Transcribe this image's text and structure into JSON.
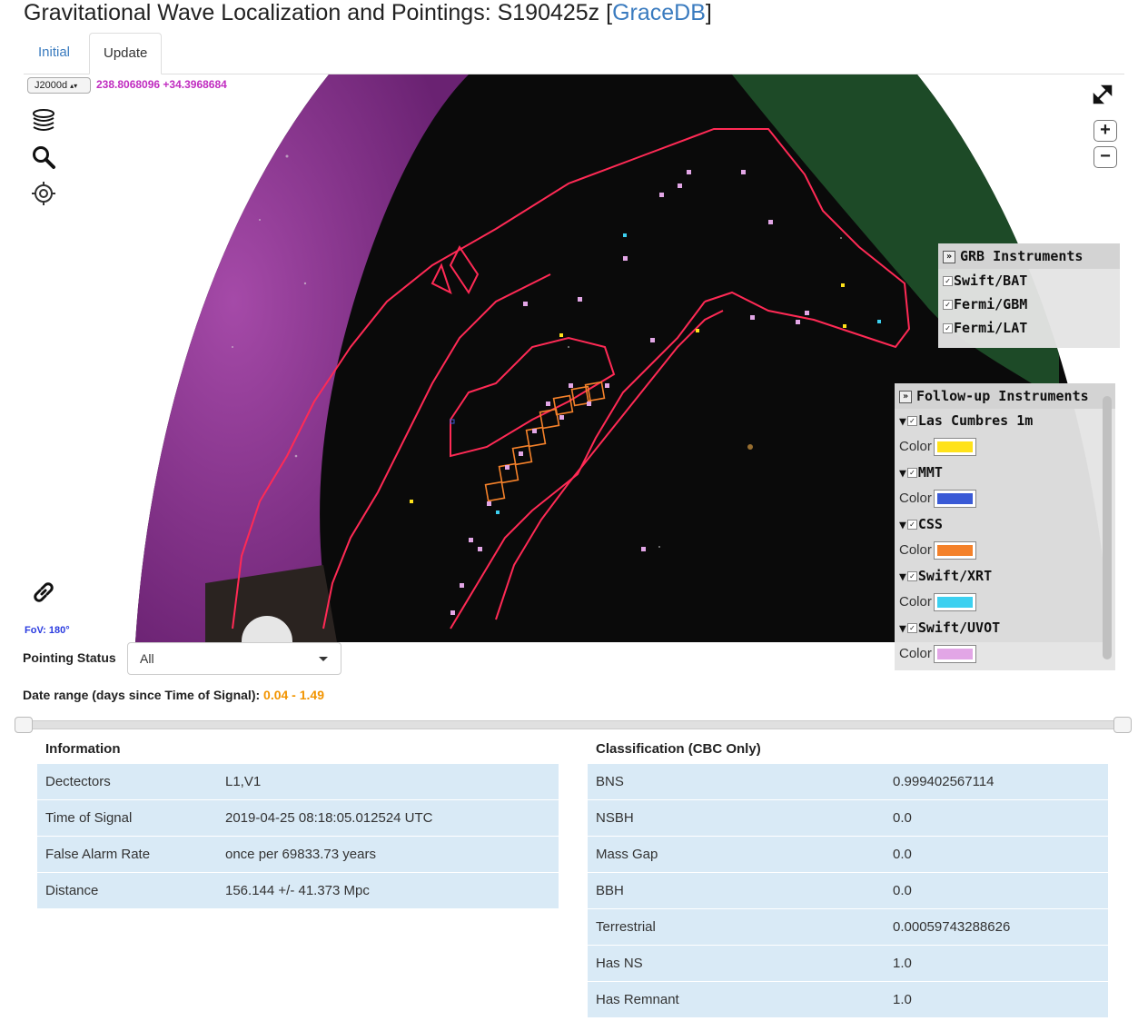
{
  "title": {
    "text": "Gravitational Wave Localization and Pointings: S190425z [",
    "link": "GraceDB",
    "suffix": "]"
  },
  "tabs": [
    {
      "label": "Initial",
      "active": false
    },
    {
      "label": "Update",
      "active": true
    }
  ],
  "sky": {
    "frame": "J2000d",
    "coords": "238.8068096 +34.3968684",
    "fov": "FoV: 180°",
    "zoom_in": "+",
    "zoom_out": "−"
  },
  "grb_panel": {
    "title": "GRB Instruments",
    "items": [
      "Swift/BAT",
      "Fermi/GBM",
      "Fermi/LAT"
    ]
  },
  "followup_panel": {
    "title": "Follow-up Instruments",
    "color_label": "Color",
    "items": [
      {
        "name": "Las Cumbres 1m",
        "color": "#ffe21a"
      },
      {
        "name": "MMT",
        "color": "#3a5ad6"
      },
      {
        "name": "CSS",
        "color": "#f4812a"
      },
      {
        "name": "Swift/XRT",
        "color": "#3cd0f0"
      },
      {
        "name": "Swift/UVOT",
        "color": "#e2a6e6"
      }
    ]
  },
  "pointing_status": {
    "label": "Pointing Status",
    "value": "All"
  },
  "date_range": {
    "label": "Date range (days since Time of Signal):",
    "value": "0.04 - 1.49"
  },
  "info": {
    "header": "Information",
    "rows": [
      [
        "Dectectors",
        "L1,V1"
      ],
      [
        "Time of Signal",
        "2019-04-25 08:18:05.012524 UTC"
      ],
      [
        "False Alarm Rate",
        "once per 69833.73 years"
      ],
      [
        "Distance",
        "156.144 +/- 41.373 Mpc"
      ]
    ]
  },
  "classification": {
    "header": "Classification (CBC Only)",
    "rows": [
      [
        "BNS",
        "0.999402567114"
      ],
      [
        "NSBH",
        "0.0"
      ],
      [
        "Mass Gap",
        "0.0"
      ],
      [
        "BBH",
        "0.0"
      ],
      [
        "Terrestrial",
        "0.00059743288626"
      ],
      [
        "Has NS",
        "1.0"
      ],
      [
        "Has Remnant",
        "1.0"
      ]
    ]
  },
  "colors": {
    "contour": "#ff2a55",
    "milky_way": "#7a2a82",
    "sky": "#080808",
    "green_region": "#1d4a27",
    "coord_text": "#c02cc0",
    "date_value": "#f29400"
  }
}
